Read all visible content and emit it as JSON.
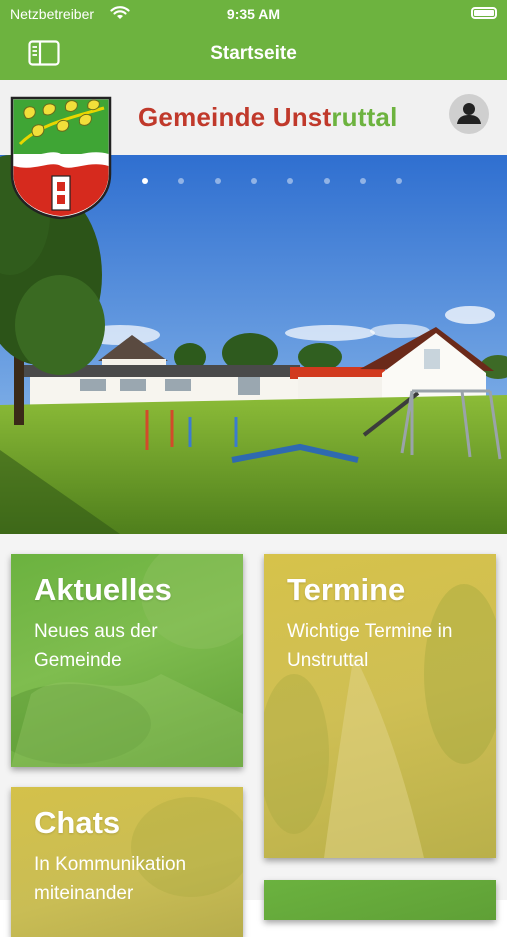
{
  "status_bar": {
    "carrier": "Netzbetreiber",
    "time": "9:35 AM"
  },
  "nav_bar": {
    "title": "Startseite"
  },
  "header": {
    "brand_part1": "Gemeinde Unst",
    "brand_part2": "ruttal"
  },
  "slider": {
    "total": 8,
    "active_index": 0
  },
  "tiles": [
    {
      "title": "Aktuelles",
      "subtitle": "Neues aus der Gemeinde"
    },
    {
      "title": "Termine",
      "subtitle": "Wichtige Termine in Unstruttal"
    },
    {
      "title": "Chats",
      "subtitle": "In Kommunikation miteinander"
    },
    {
      "title": "",
      "subtitle": ""
    }
  ],
  "colors": {
    "brand_green": "#6db33f",
    "brand_red": "#c0392b"
  },
  "icons": [
    "wifi-icon",
    "battery-icon",
    "sidebar-toggle-icon",
    "profile-icon",
    "coat-of-arms-crest"
  ]
}
